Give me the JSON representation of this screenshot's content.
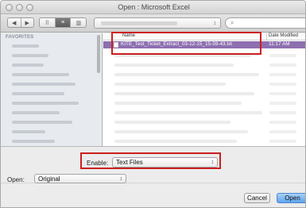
{
  "window": {
    "title": "Open : Microsoft Excel"
  },
  "toolbar": {
    "back_icon": "chevron-left-icon",
    "forward_icon": "chevron-right-icon",
    "view_modes": [
      "icon-view-icon",
      "list-view-icon",
      "column-view-icon"
    ],
    "path_popup_arrows": "↕",
    "search_placeholder": "",
    "search_glyph": "⌕"
  },
  "sidebar": {
    "heading": "FAVORITES"
  },
  "file_list": {
    "columns": {
      "name": "Name",
      "date_modified": "Date Modified"
    },
    "selected_file": {
      "name": "KITE_Test_Ticket_Extract_03-12-15_15-59-43.txt",
      "date_modified": "11:17 AM"
    }
  },
  "options": {
    "enable_label": "Enable:",
    "enable_value": "Text Files",
    "open_label": "Open:",
    "open_value": "Original",
    "select_arrows": "↕"
  },
  "buttons": {
    "cancel": "Cancel",
    "open": "Open"
  },
  "colors": {
    "selection": "#8e6fb0",
    "highlight_box": "#cc1f1f",
    "default_button": "#5fa4ee"
  }
}
